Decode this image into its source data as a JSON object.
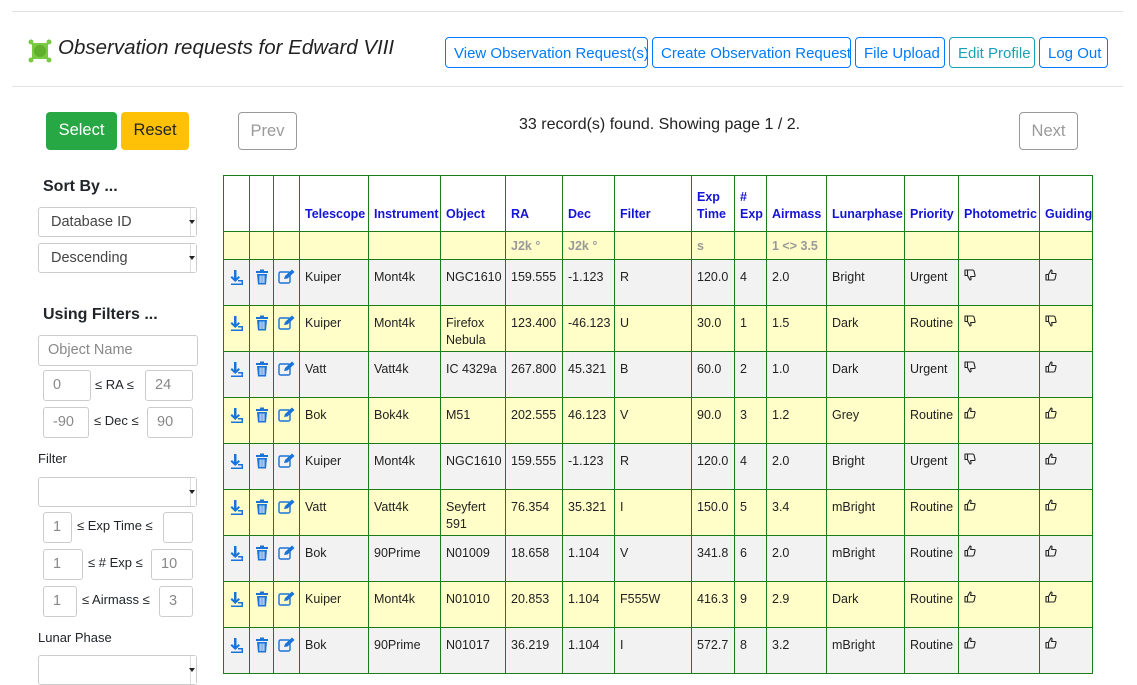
{
  "header": {
    "title": "Observation requests for Edward VIII",
    "nav": [
      {
        "label": "View Observation Request(s)"
      },
      {
        "label": "Create Observation Request"
      },
      {
        "label": "File Upload"
      },
      {
        "label": "Edit Profile"
      },
      {
        "label": "Log Out"
      }
    ]
  },
  "actions": {
    "select": "Select",
    "reset": "Reset"
  },
  "pager": {
    "prev": "Prev",
    "next": "Next",
    "status": "33 record(s) found. Showing page 1 / 2."
  },
  "sidebar": {
    "sort_heading": "Sort By ...",
    "sort_field": "Database ID",
    "sort_order": "Descending",
    "filter_heading": "Using Filters ...",
    "object_placeholder": "Object Name",
    "ra": {
      "min": "0",
      "label": "≤ RA ≤",
      "max": "24"
    },
    "dec": {
      "min": "-90",
      "label": "≤ Dec ≤",
      "max": "90"
    },
    "filter_label": "Filter",
    "filter_value": "",
    "exptime": {
      "min": "1",
      "label": "≤ Exp Time ≤",
      "max": ""
    },
    "nexp": {
      "min": "1",
      "label": "≤ # Exp ≤",
      "max": "10"
    },
    "airmass": {
      "min": "1",
      "label": "≤ Airmass ≤",
      "max": "3"
    },
    "lunar_label": "Lunar Phase"
  },
  "table": {
    "columns": [
      "Telescope",
      "Instrument",
      "Object",
      "RA",
      "Dec",
      "Filter",
      "Exp Time",
      "# Exp",
      "Airmass",
      "Lunarphase",
      "Priority",
      "Photometric",
      "Guiding"
    ],
    "units": [
      "",
      "",
      "",
      "J2k °",
      "J2k °",
      "",
      "s",
      "",
      "1 <> 3.5",
      "",
      "",
      "",
      ""
    ],
    "rows": [
      {
        "telescope": "Kuiper",
        "instrument": "Mont4k",
        "object": "NGC1610",
        "ra": "159.555",
        "dec": "-1.123",
        "filter": "R",
        "exptime": "120.0",
        "nexp": "4",
        "airmass": "2.0",
        "lunarphase": "Bright",
        "priority": "Urgent",
        "photometric": "thumbs-down-icon",
        "guiding": "thumbs-up-icon"
      },
      {
        "telescope": "Kuiper",
        "instrument": "Mont4k",
        "object": "Firefox Nebula",
        "ra": "123.400",
        "dec": "-46.123",
        "filter": "U",
        "exptime": "30.0",
        "nexp": "1",
        "airmass": "1.5",
        "lunarphase": "Dark",
        "priority": "Routine",
        "photometric": "thumbs-down-icon",
        "guiding": "thumbs-down-icon"
      },
      {
        "telescope": "Vatt",
        "instrument": "Vatt4k",
        "object": "IC 4329a",
        "ra": "267.800",
        "dec": "45.321",
        "filter": "B",
        "exptime": "60.0",
        "nexp": "2",
        "airmass": "1.0",
        "lunarphase": "Dark",
        "priority": "Urgent",
        "photometric": "thumbs-down-icon",
        "guiding": "thumbs-up-icon"
      },
      {
        "telescope": "Bok",
        "instrument": "Bok4k",
        "object": "M51",
        "ra": "202.555",
        "dec": "46.123",
        "filter": "V",
        "exptime": "90.0",
        "nexp": "3",
        "airmass": "1.2",
        "lunarphase": "Grey",
        "priority": "Routine",
        "photometric": "thumbs-up-icon",
        "guiding": "thumbs-up-icon"
      },
      {
        "telescope": "Kuiper",
        "instrument": "Mont4k",
        "object": "NGC1610",
        "ra": "159.555",
        "dec": "-1.123",
        "filter": "R",
        "exptime": "120.0",
        "nexp": "4",
        "airmass": "2.0",
        "lunarphase": "Bright",
        "priority": "Urgent",
        "photometric": "thumbs-down-icon",
        "guiding": "thumbs-up-icon"
      },
      {
        "telescope": "Vatt",
        "instrument": "Vatt4k",
        "object": "Seyfert 591",
        "ra": "76.354",
        "dec": "35.321",
        "filter": "I",
        "exptime": "150.0",
        "nexp": "5",
        "airmass": "3.4",
        "lunarphase": "mBright",
        "priority": "Routine",
        "photometric": "thumbs-up-icon",
        "guiding": "thumbs-up-icon"
      },
      {
        "telescope": "Bok",
        "instrument": "90Prime",
        "object": "N01009",
        "ra": "18.658",
        "dec": "1.104",
        "filter": "V",
        "exptime": "341.8",
        "nexp": "6",
        "airmass": "2.0",
        "lunarphase": "mBright",
        "priority": "Routine",
        "photometric": "thumbs-up-icon",
        "guiding": "thumbs-up-icon"
      },
      {
        "telescope": "Kuiper",
        "instrument": "Mont4k",
        "object": "N01010",
        "ra": "20.853",
        "dec": "1.104",
        "filter": "F555W",
        "exptime": "416.3",
        "nexp": "9",
        "airmass": "2.9",
        "lunarphase": "Dark",
        "priority": "Routine",
        "photometric": "thumbs-up-icon",
        "guiding": "thumbs-up-icon"
      },
      {
        "telescope": "Bok",
        "instrument": "90Prime",
        "object": "N01017",
        "ra": "36.219",
        "dec": "1.104",
        "filter": "I",
        "exptime": "572.7",
        "nexp": "8",
        "airmass": "3.2",
        "lunarphase": "mBright",
        "priority": "Routine",
        "photometric": "thumbs-up-icon",
        "guiding": "thumbs-up-icon"
      }
    ]
  }
}
